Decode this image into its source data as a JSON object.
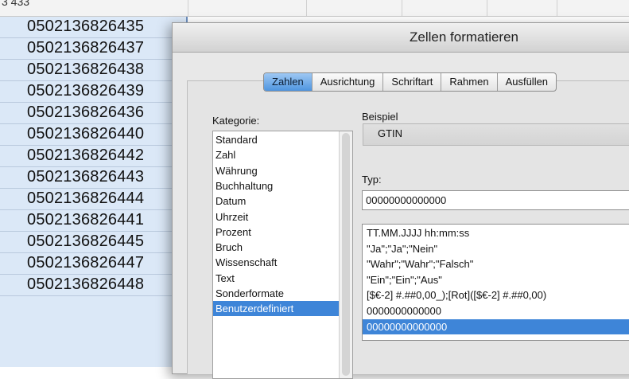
{
  "spreadsheet": {
    "top_fragment": "3  433",
    "rows": [
      "0502136826435",
      "0502136826437",
      "0502136826438",
      "0502136826439",
      "0502136826436",
      "0502136826440",
      "0502136826442",
      "0502136826443",
      "0502136826444",
      "0502136826441",
      "0502136826445",
      "0502136826447",
      "0502136826448"
    ]
  },
  "dialog": {
    "title": "Zellen formatieren",
    "tabs": [
      "Zahlen",
      "Ausrichtung",
      "Schriftart",
      "Rahmen",
      "Ausfüllen"
    ],
    "active_tab": "Zahlen",
    "category_label": "Kategorie:",
    "categories": [
      "Standard",
      "Zahl",
      "Währung",
      "Buchhaltung",
      "Datum",
      "Uhrzeit",
      "Prozent",
      "Bruch",
      "Wissenschaft",
      "Text",
      "Sonderformate",
      "Benutzerdefiniert"
    ],
    "selected_category": "Benutzerdefiniert",
    "example_label": "Beispiel",
    "example_value": "GTIN",
    "type_label": "Typ:",
    "type_value": "00000000000000",
    "formats": [
      "TT.MM.JJJJ hh:mm:ss",
      "\"Ja\";\"Ja\";\"Nein\"",
      "\"Wahr\";\"Wahr\";\"Falsch\"",
      "\"Ein\";\"Ein\";\"Aus\"",
      "[$€-2] #.##0,00_);[Rot]([$€-2] #.##0,00)",
      "0000000000000",
      "00000000000000"
    ],
    "selected_format": "00000000000000"
  },
  "colors": {
    "selection_blue": "#3e85d8",
    "sheet_selection": "#dbe8f7"
  }
}
